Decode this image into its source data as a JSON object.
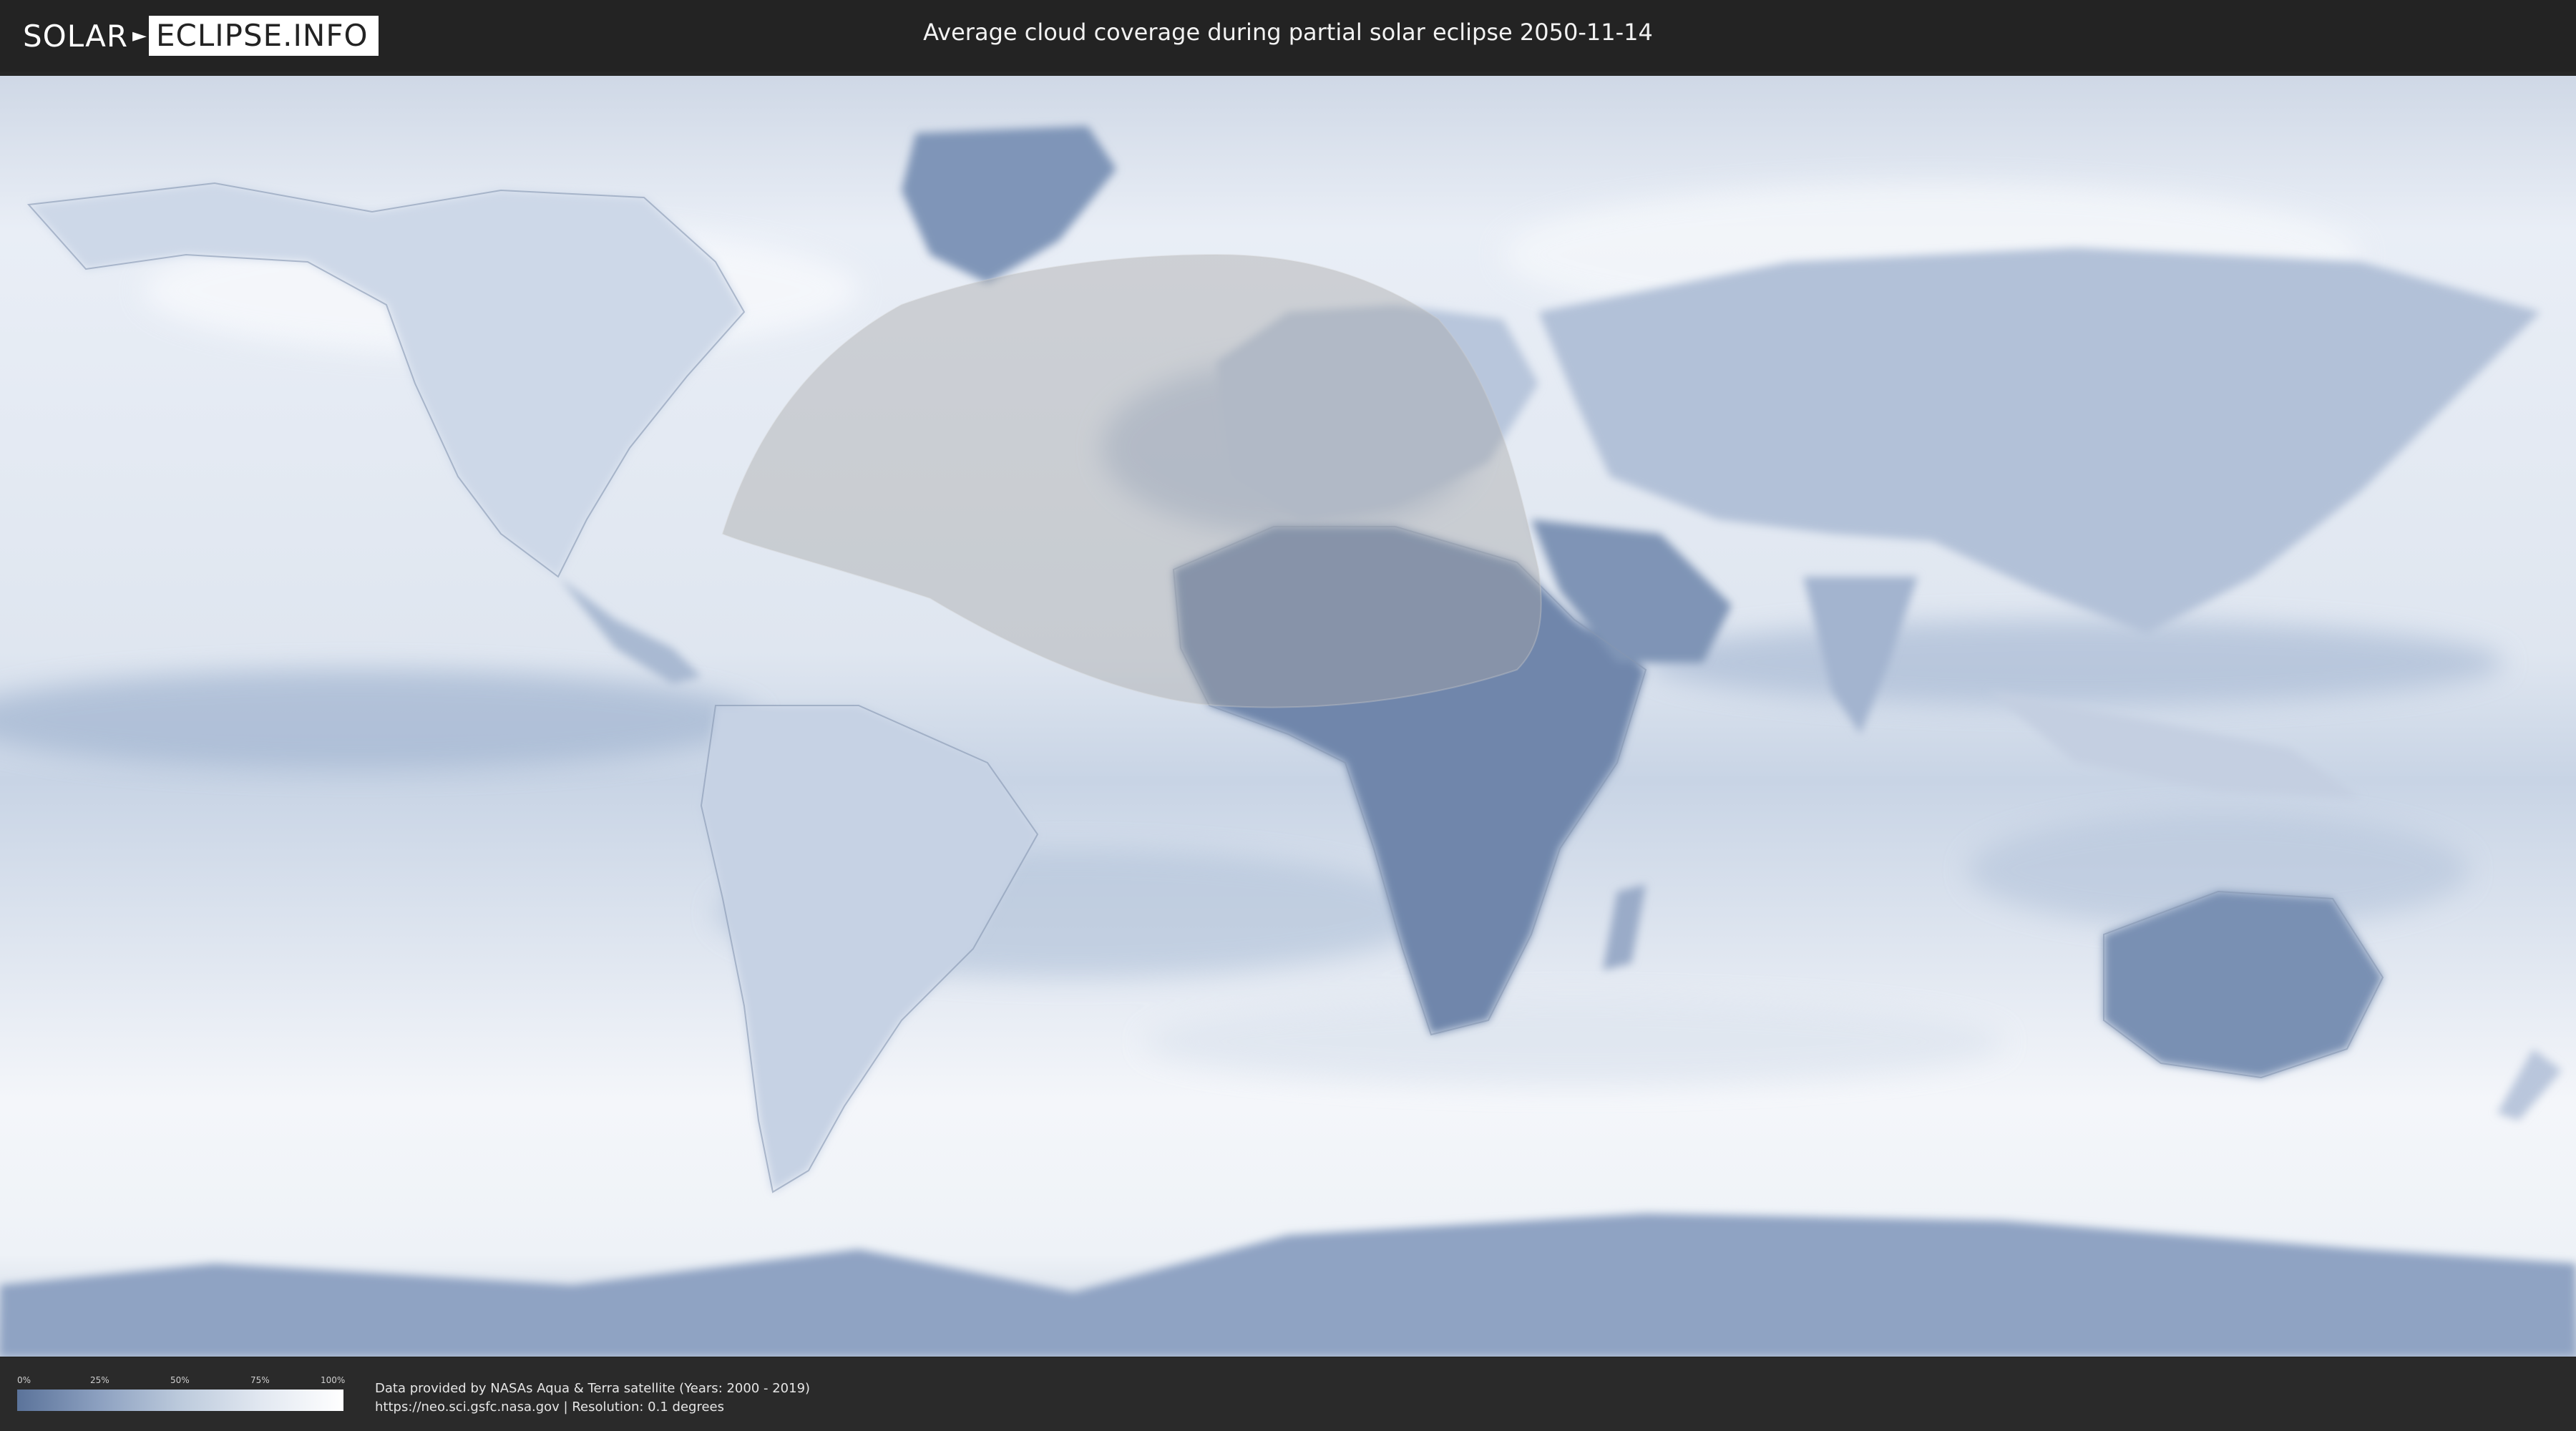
{
  "header": {
    "logo_left": "SOLAR",
    "logo_right": "ECLIPSE.INFO",
    "title": "Average cloud coverage during partial solar eclipse 2050-11-14"
  },
  "legend": {
    "ticks": [
      "0%",
      "25%",
      "50%",
      "75%",
      "100%"
    ],
    "colors": [
      "#5b739a",
      "#8ca0c0",
      "#bccadc",
      "#e2e8f1",
      "#ffffff"
    ]
  },
  "footer": {
    "line1": "Data provided by NASAs Aqua & Terra satellite (Years: 2000 - 2019)",
    "line2": "https://neo.sci.gsfc.nasa.gov | Resolution: 0.1 degrees"
  },
  "map": {
    "projection": "equirectangular",
    "eclipse_zone": "partial solar eclipse visibility region over North Atlantic, Europe and North Africa",
    "colors": {
      "ocean_cloud": "#e9eef6",
      "clear_land": "#6f86ab",
      "shadow": "#bdbdbd"
    }
  }
}
